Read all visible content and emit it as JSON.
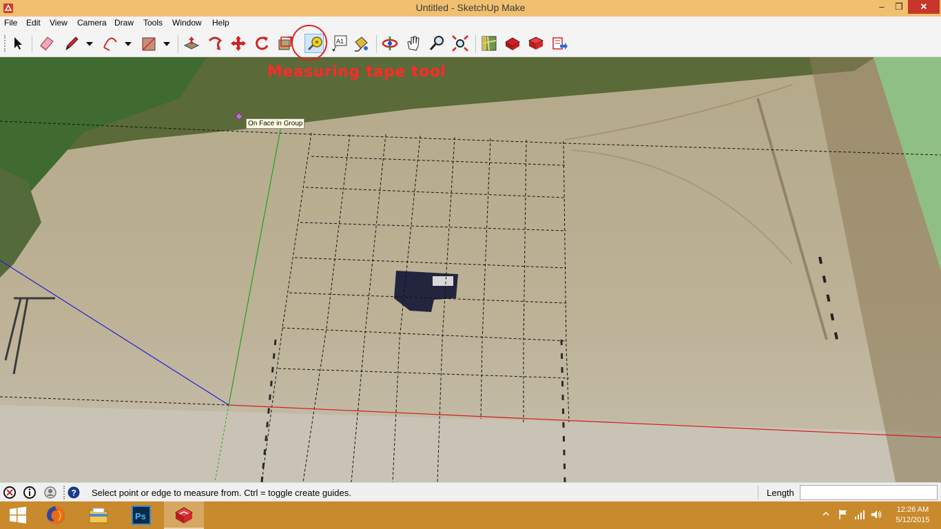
{
  "window": {
    "title": "Untitled - SketchUp Make",
    "controls": {
      "minimize": "–",
      "maximize": "❐",
      "close": "✕"
    }
  },
  "menu": [
    "File",
    "Edit",
    "View",
    "Camera",
    "Draw",
    "Tools",
    "Window",
    "Help"
  ],
  "toolbar": {
    "tools": [
      "select-icon",
      "eraser-icon",
      "pencil-icon",
      "arc-icon",
      "rectangle-icon",
      "push-pull-icon",
      "follow-me-icon",
      "move-icon",
      "rotate-icon",
      "scale-icon",
      "tape-measure-icon",
      "text-icon",
      "paint-bucket-icon",
      "orbit-icon",
      "pan-icon",
      "zoom-icon",
      "zoom-extents-icon",
      "add-location-icon",
      "geo-terrain-icon",
      "3d-warehouse-icon",
      "extension-warehouse-icon"
    ],
    "active_tool": "tape-measure-icon",
    "text_tool_label": "A1"
  },
  "viewport": {
    "annotation": "Measuring tape tool",
    "inference_tooltip": "On Face in Group",
    "axis_colors": {
      "red": "#d01e1e",
      "green": "#1fa01f",
      "blue": "#1e1ed0"
    }
  },
  "status": {
    "text": "Select point or edge to measure from.  Ctrl = toggle create guides.",
    "vcb_label": "Length",
    "vcb_value": ""
  },
  "taskbar": {
    "apps": [
      "windows-start-icon",
      "firefox-icon",
      "file-explorer-icon",
      "photoshop-icon",
      "sketchup-icon"
    ],
    "active_app": "sketchup-icon",
    "photoshop_label": "Ps",
    "clock_time": "12:26 AM",
    "clock_date": "5/12/2015"
  }
}
